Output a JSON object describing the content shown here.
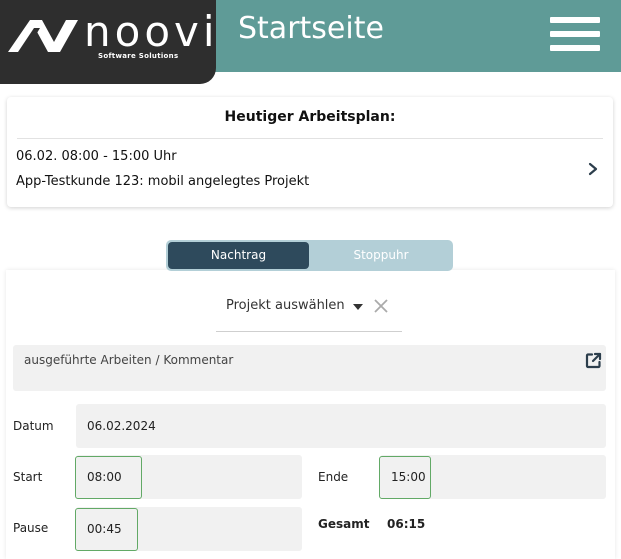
{
  "header": {
    "logo_text": "noovi",
    "logo_tagline": "Software Solutions",
    "title": "Startseite",
    "menu_icon": "hamburger-menu-icon",
    "background_color": "#5f9b97",
    "logo_background": "#2e2e2e"
  },
  "work_plan": {
    "title": "Heutiger Arbeitsplan:",
    "entries": [
      {
        "time": "06.02. 08:00 - 15:00 Uhr",
        "project": "App-Testkunde 123: mobil angelegtes Projekt",
        "icon": "chevron-right-icon"
      }
    ]
  },
  "mode_toggle": {
    "options": [
      "Nachtrag",
      "Stoppuhr"
    ],
    "selected": "Nachtrag",
    "active_color": "#2e4a5c",
    "inactive_color": "#b3cfd7"
  },
  "form": {
    "project_select": {
      "label": "Projekt auswählen",
      "caret_icon": "caret-down-icon",
      "clear_icon": "close-icon"
    },
    "comment": {
      "placeholder": "ausgeführte Arbeiten / Kommentar",
      "icon": "external-link-icon"
    },
    "date": {
      "label": "Datum",
      "value": "06.02.2024"
    },
    "start": {
      "label": "Start",
      "value": "08:00"
    },
    "end": {
      "label": "Ende",
      "value": "15:00"
    },
    "pause": {
      "label": "Pause",
      "value": "00:45"
    },
    "total": {
      "label": "Gesamt",
      "value": "06:15"
    },
    "highlight_color": "#62a966"
  }
}
